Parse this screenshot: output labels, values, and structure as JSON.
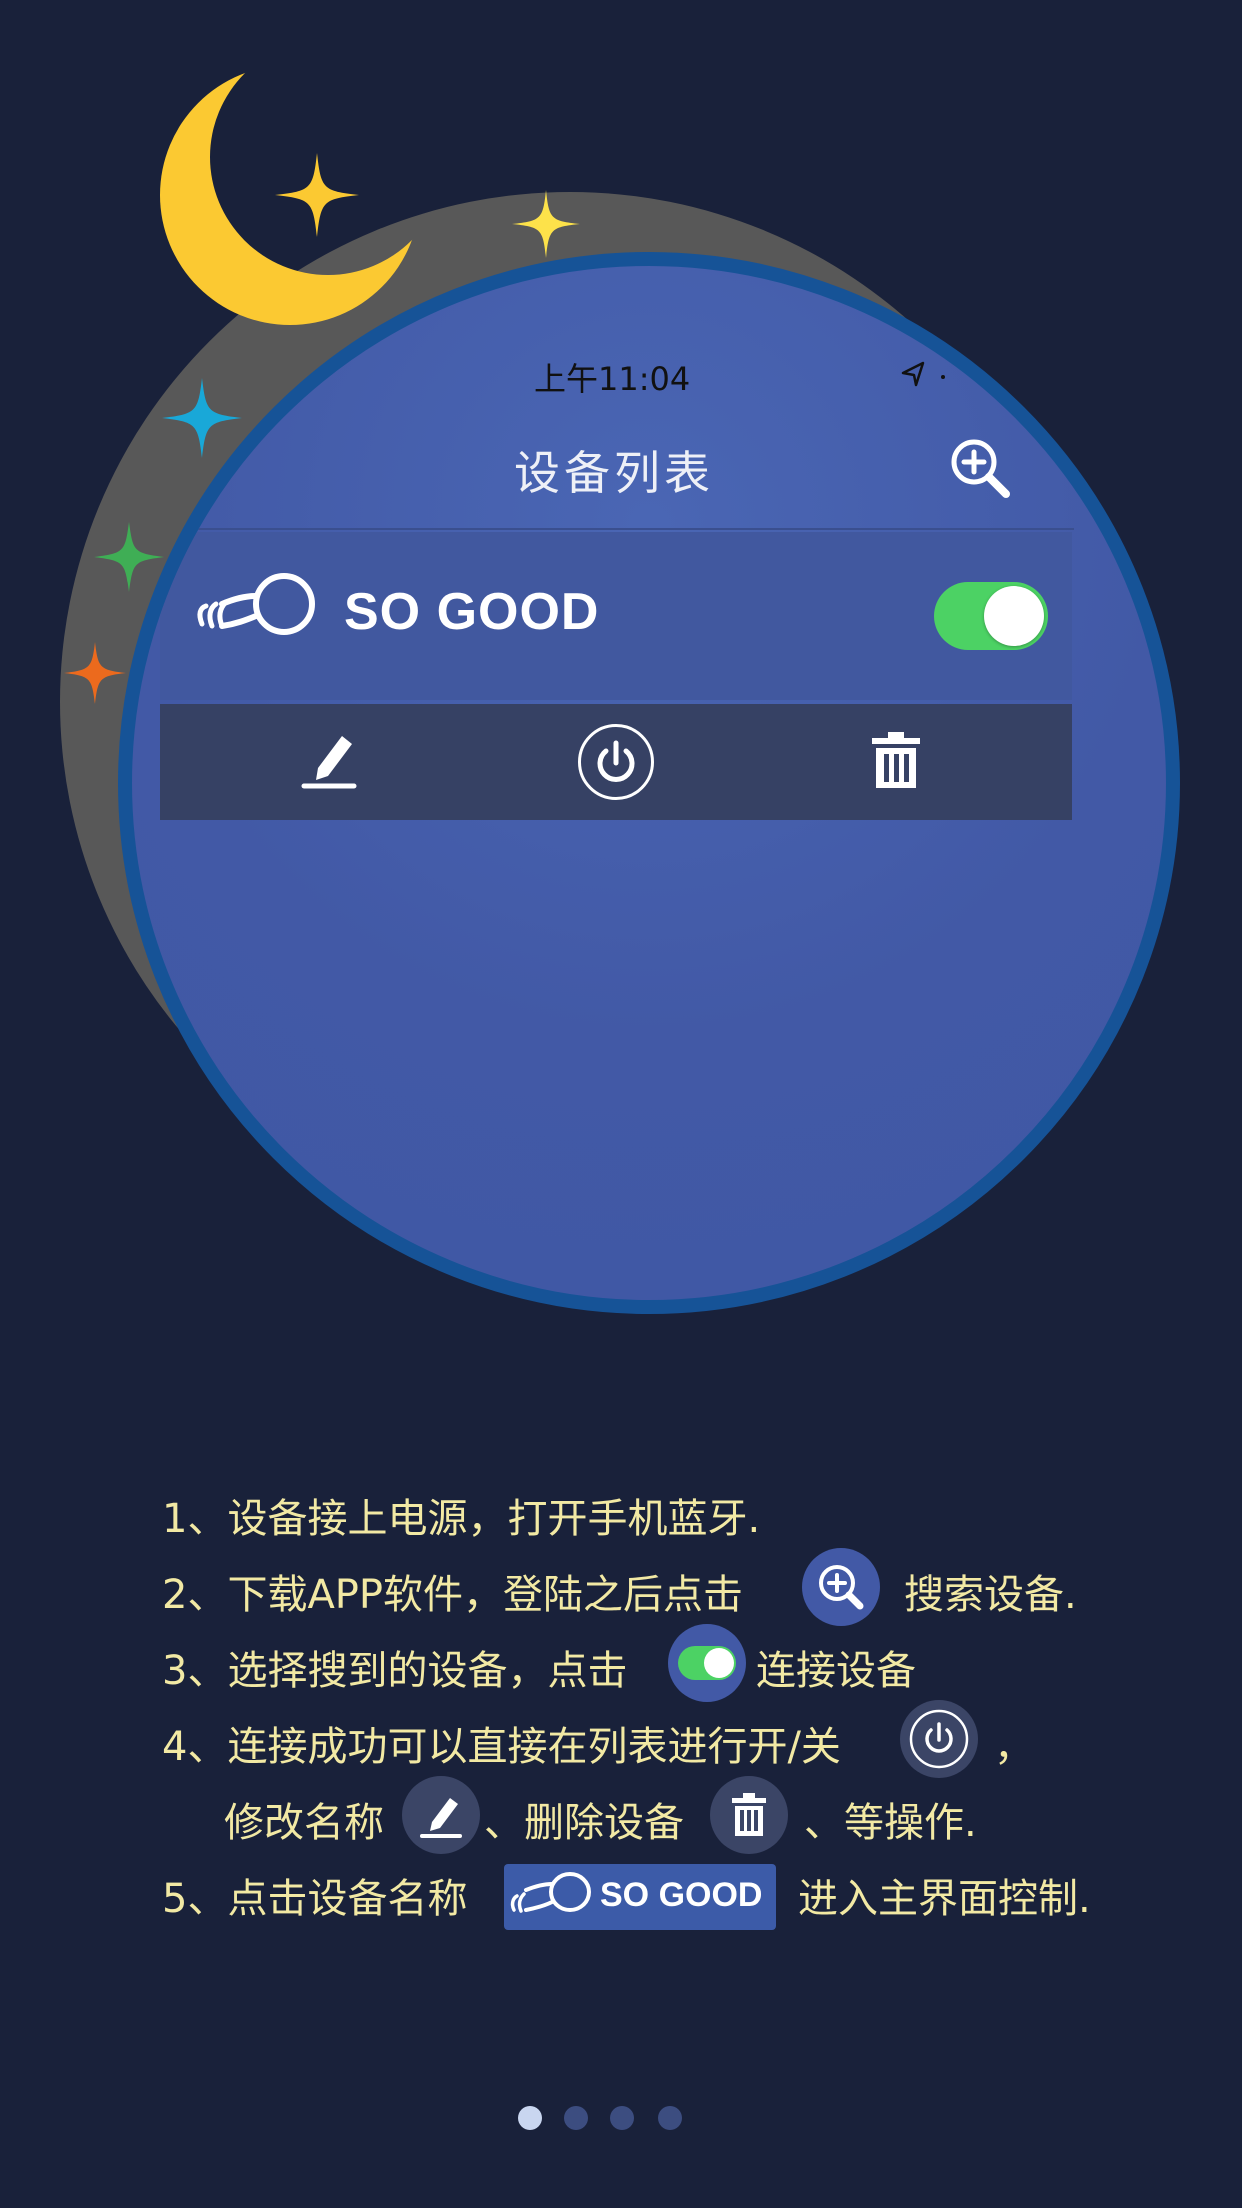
{
  "status_bar": {
    "time": "上午11:04"
  },
  "nav": {
    "title": "设备列表",
    "search_icon": "search-zoom-icon"
  },
  "device": {
    "name": "SO GOOD",
    "connected": true,
    "icon": "bulb-icon"
  },
  "actions": [
    "edit-icon",
    "power-icon",
    "trash-icon"
  ],
  "instructions": {
    "line1": "1、设备接上电源，打开手机蓝牙.",
    "line2_a": "2、下载APP软件，登陆之后点击",
    "line2_b": "搜索设备.",
    "line3_a": "3、选择搜到的设备，点击",
    "line3_b": "连接设备",
    "line4_a": "4、连接成功可以直接在列表进行开/关",
    "line4_b": "，",
    "line4c_a": "修改名称",
    "line4c_b": "、删除设备",
    "line4c_c": "、等操作.",
    "line5_a": "5、点击设备名称",
    "line5_badge": "SO GOOD",
    "line5_b": "进入主界面控制."
  },
  "pagination": {
    "total": 4,
    "current": 1
  },
  "colors": {
    "background": "#19213a",
    "lens": "#4259a6",
    "lens_border": "#165397",
    "toggle_on": "#4cd264",
    "instruction_text": "#f2e9a4",
    "moon": "#fbc932"
  }
}
